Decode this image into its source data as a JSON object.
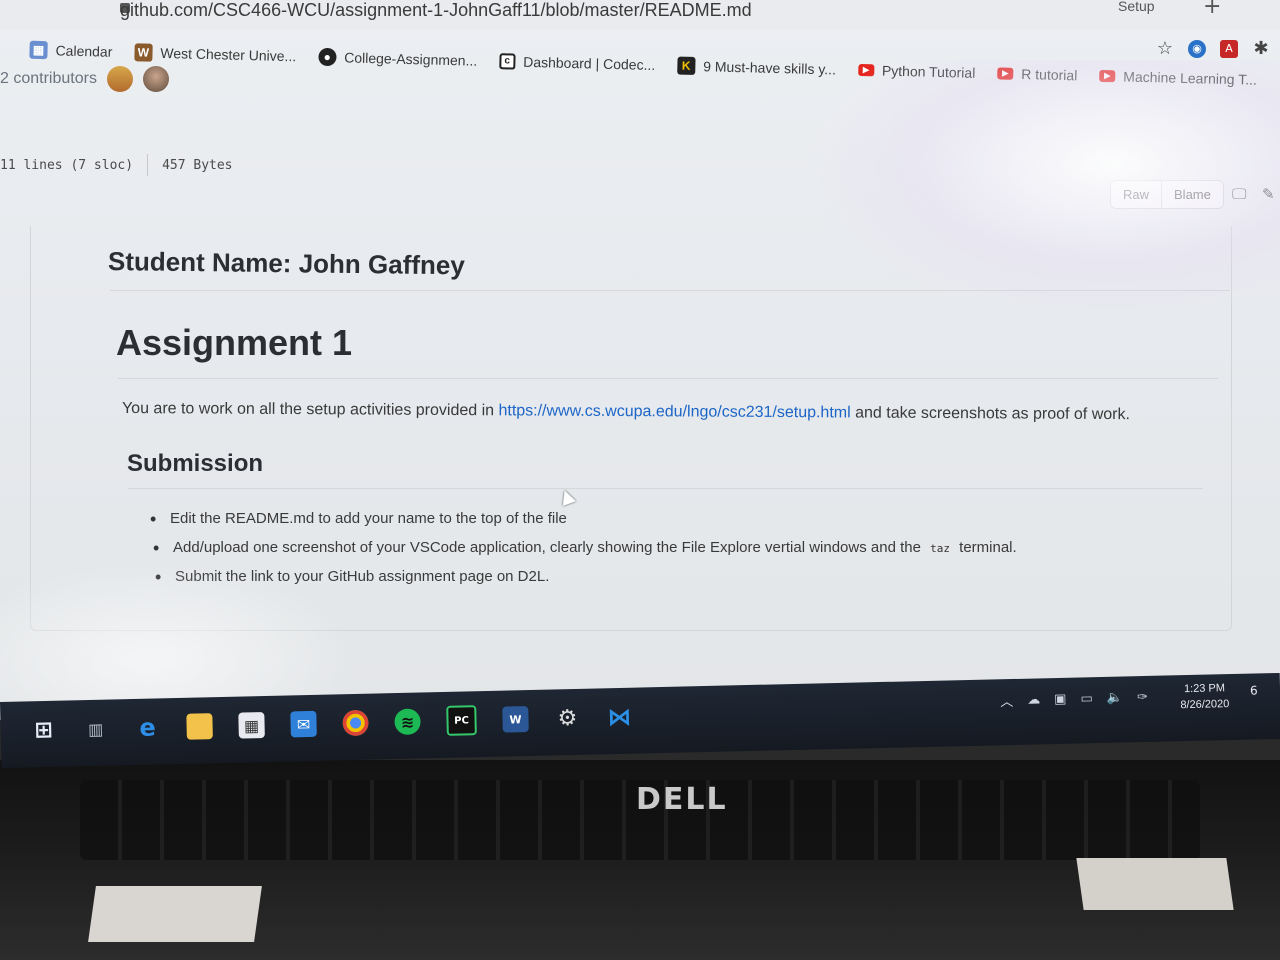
{
  "browser": {
    "url": "github.com/CSC466-WCU/assignment-1-JohnGaff11/blob/master/README.md",
    "setup_label": "Setup",
    "new_tab": "+"
  },
  "bookmarks": [
    {
      "icon": "calendar-icon",
      "label": "Calendar"
    },
    {
      "icon": "w-icon",
      "label": "West Chester Unive..."
    },
    {
      "icon": "github-icon",
      "label": "College-Assignmen..."
    },
    {
      "icon": "codecademy-icon",
      "label": "Dashboard | Codec..."
    },
    {
      "icon": "k-icon",
      "label": "9 Must-have skills y..."
    },
    {
      "icon": "youtube-icon",
      "label": "Python Tutorial"
    },
    {
      "icon": "youtube-icon",
      "label": "R tutorial"
    },
    {
      "icon": "youtube-icon",
      "label": "Machine Learning T..."
    }
  ],
  "repo": {
    "contributors": "2 contributors",
    "lines": "11 lines (7 sloc)",
    "size": "457 Bytes",
    "raw_label": "Raw",
    "blame_label": "Blame"
  },
  "readme": {
    "student_heading": "Student Name: John Gaffney",
    "title": "Assignment 1",
    "intro_before": "You are to work on all the setup activities provided in ",
    "intro_link": "https://www.cs.wcupa.edu/lngo/csc231/setup.html",
    "intro_after": " and take screenshots as proof of work.",
    "submission_heading": "Submission",
    "item1": "Edit the README.md to add your name to the top of the file",
    "item2_before": "Add/upload one screenshot of your VSCode application, clearly showing the File Explore vertial windows and the ",
    "item2_code": "taz",
    "item2_after": " terminal.",
    "item3": "Submit the link to your GitHub assignment page on D2L."
  },
  "taskbar": {
    "time": "1:23 PM",
    "date": "8/26/2020",
    "notifications": "6"
  },
  "laptop": {
    "brand": "DELL"
  }
}
